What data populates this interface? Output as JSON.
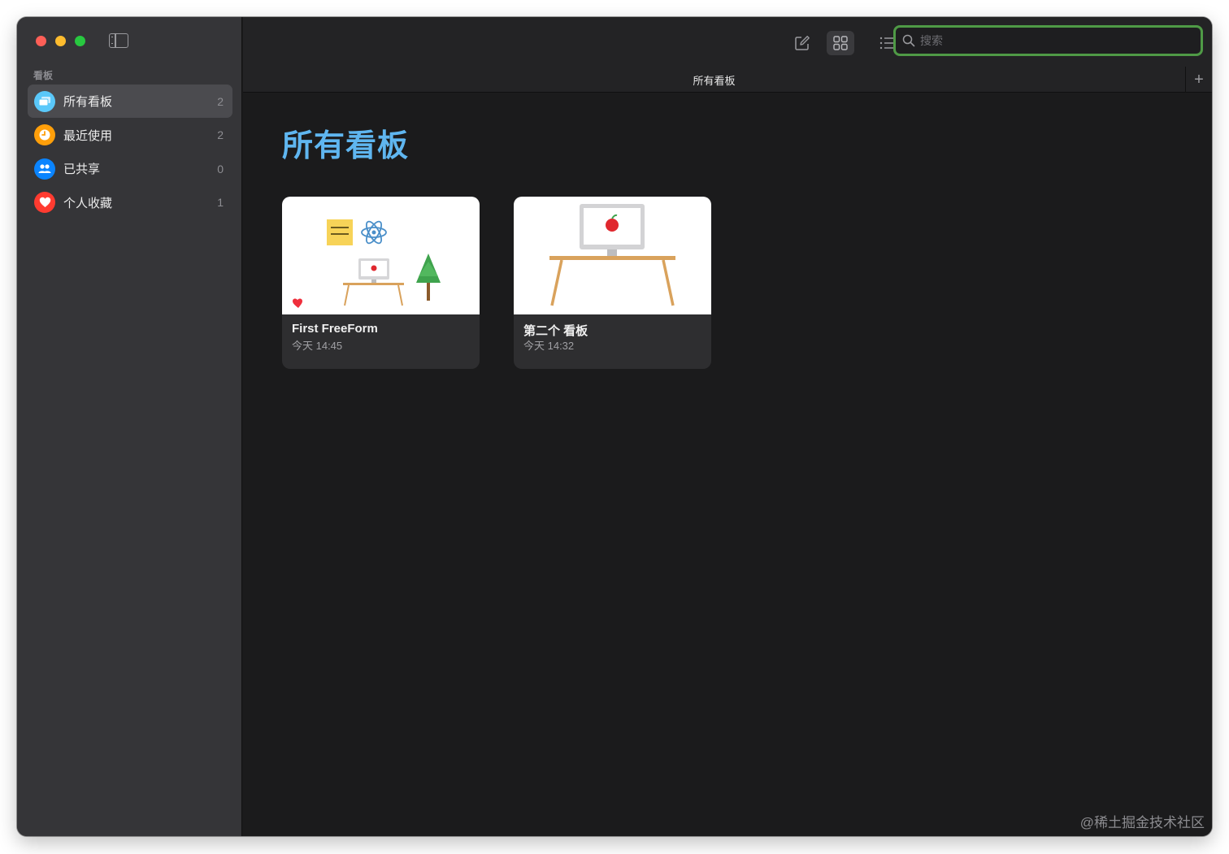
{
  "sidebar": {
    "section_label": "看板",
    "items": [
      {
        "label": "所有看板",
        "count": "2",
        "color": "#5ac8fa"
      },
      {
        "label": "最近使用",
        "count": "2",
        "color": "#ff9f0a"
      },
      {
        "label": "已共享",
        "count": "0",
        "color": "#0a84ff"
      },
      {
        "label": "个人收藏",
        "count": "1",
        "color": "#ff3b30"
      }
    ]
  },
  "toolbar": {
    "search_placeholder": "搜索",
    "tab_title": "所有看板",
    "add_tab": "+"
  },
  "main": {
    "title": "所有看板",
    "boards": [
      {
        "title": "First FreeForm",
        "date": "今天 14:45"
      },
      {
        "title": "第二个 看板",
        "date": "今天 14:32"
      }
    ]
  },
  "watermark": "@稀土掘金技术社区",
  "colors": {
    "accent_title": "#5fb6f0",
    "search_focus_ring": "#4f9a46"
  }
}
